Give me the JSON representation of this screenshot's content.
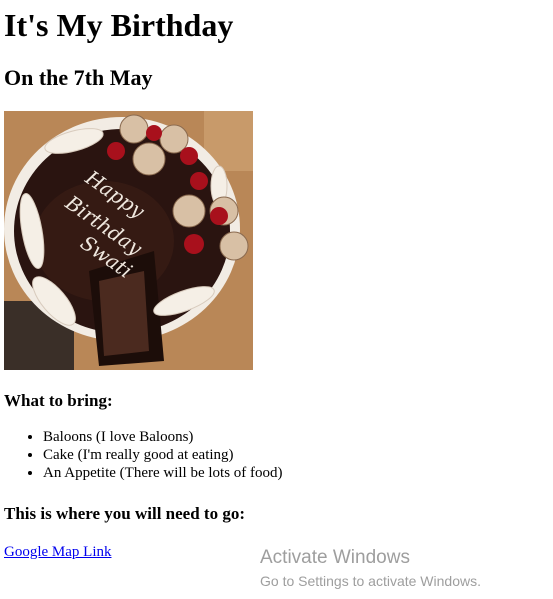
{
  "page": {
    "title": "It's My Birthday",
    "subtitle": "On the 7th May"
  },
  "image": {
    "icon": "birthday-cake-photo",
    "cake_text": [
      "Happy",
      "Birthday",
      "Swati"
    ]
  },
  "bring": {
    "heading": "What to bring:",
    "items": [
      "Baloons (I love Baloons)",
      "Cake (I'm really good at eating)",
      "An Appetite (There will be lots of food)"
    ]
  },
  "location": {
    "heading": "This is where you will need to go:",
    "link_label": "Google Map Link"
  },
  "watermark": {
    "title": "Activate Windows",
    "subtitle": "Go to Settings to activate Windows."
  },
  "colors": {
    "link": "#0000ee",
    "watermark": "#9e9e9e"
  }
}
